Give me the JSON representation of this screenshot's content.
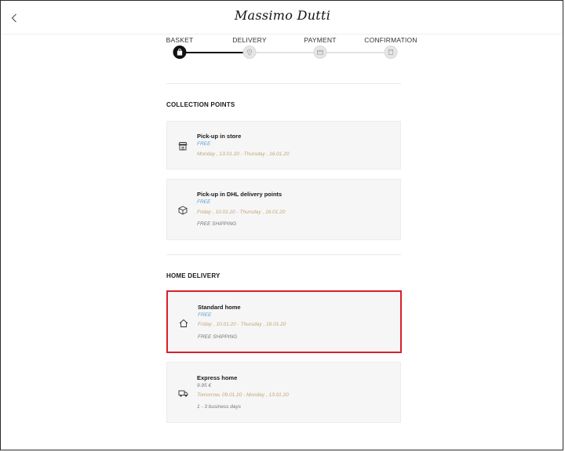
{
  "header": {
    "logo": "Massimo Dutti",
    "back_icon": "chevron-left-icon"
  },
  "steps": [
    {
      "label": "BASKET",
      "state": "active",
      "icon": "bag-icon"
    },
    {
      "label": "DELIVERY",
      "state": "upcoming",
      "icon": "location-pin-icon"
    },
    {
      "label": "PAYMENT",
      "state": "upcoming",
      "icon": "card-icon"
    },
    {
      "label": "CONFIRMATION",
      "state": "upcoming",
      "icon": "document-icon"
    }
  ],
  "sections": {
    "collection": {
      "title": "COLLECTION POINTS",
      "options": [
        {
          "name": "Pick-up in store",
          "price": "FREE",
          "dates": "Monday , 13.01.20 - Thursday , 16.01.20",
          "note": "",
          "icon": "store-icon"
        },
        {
          "name": "Pick-up in DHL delivery points",
          "price": "FREE",
          "dates": "Friday , 10.01.20 - Thursday , 16.01.20",
          "note": "FREE SHIPPING",
          "icon": "package-icon"
        }
      ]
    },
    "home": {
      "title": "HOME DELIVERY",
      "options": [
        {
          "name": "Standard home",
          "price": "FREE",
          "dates": "Friday , 10.01.20 - Thursday , 16.01.20",
          "note": "FREE SHIPPING",
          "icon": "house-icon",
          "selected": true
        },
        {
          "name": "Express home",
          "price": "9.95 €",
          "dates": "Tomorrow, 09.01.20 - Monday , 13.01.20",
          "note": "1 - 3 business days",
          "icon": "truck-icon"
        }
      ]
    }
  },
  "colors": {
    "accent_selected": "#d9202a",
    "free_text": "#5b9fd6",
    "date_text": "#c4a57a"
  }
}
